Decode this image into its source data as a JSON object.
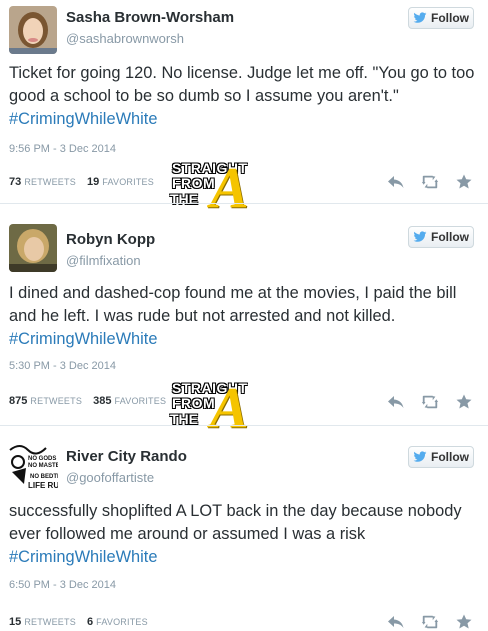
{
  "tweets": [
    {
      "name": "Sasha Brown-Worsham",
      "handle": "@sashabrownworsh",
      "follow_label": "Follow",
      "text_before": "Ticket for going 120. No license. Judge let me off. \"You go to too good a school to be so dumb so I assume you aren't.\" ",
      "hashtag": "#CrimingWhileWhite",
      "text_after": "",
      "time": "9:56 PM - 3 Dec 2014",
      "retweets": "73",
      "retweets_label": "RETWEETS",
      "favorites": "19",
      "favorites_label": "FAVORITES"
    },
    {
      "name": "Robyn Kopp",
      "handle": "@filmfixation",
      "follow_label": "Follow",
      "text_before": "I dined and dashed-cop found me at the movies, I paid the bill and he left. I was rude but not arrested and not killed. ",
      "hashtag": "#CrimingWhileWhite",
      "text_after": "",
      "time": "5:30 PM - 3 Dec 2014",
      "retweets": "875",
      "retweets_label": "RETWEETS",
      "favorites": "385",
      "favorites_label": "FAVORITES"
    },
    {
      "name": "River City Rando",
      "handle": "@goofoffartiste",
      "follow_label": "Follow",
      "text_before": "successfully shoplifted A LOT back in the day because nobody ever followed me around or assumed I was a risk ",
      "hashtag": "#CrimingWhileWhite",
      "text_after": "",
      "time": "6:50 PM - 3 Dec 2014",
      "retweets": "15",
      "retweets_label": "RETWEETS",
      "favorites": "6",
      "favorites_label": "FAVORITES"
    }
  ],
  "watermark": {
    "line1": "STRAIGHT",
    "line2": "FROM",
    "line3": "THE",
    "letter": "A"
  },
  "icons": [
    "twitter-bird-icon",
    "reply-icon",
    "retweet-icon",
    "favorite-star-icon"
  ],
  "colors": {
    "hashtag": "#2b7bb9",
    "meta": "#8899a6",
    "twitter_blue": "#55acee",
    "watermark_a": "#f5c400"
  }
}
